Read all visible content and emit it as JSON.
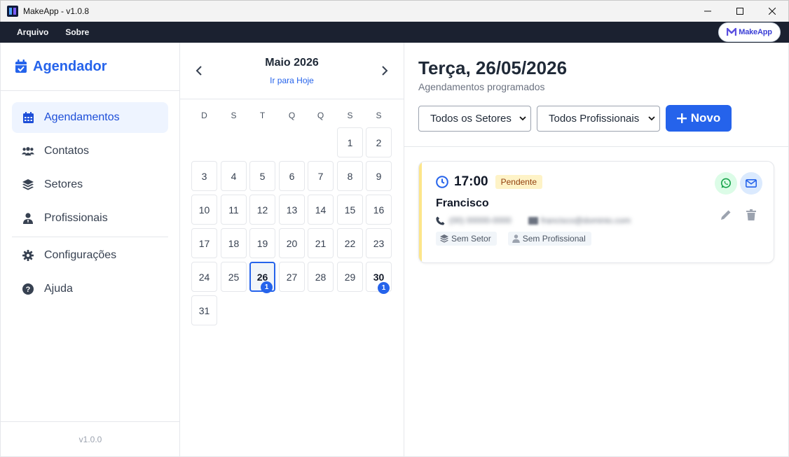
{
  "window": {
    "title": "MakeApp - v1.0.8"
  },
  "menubar": {
    "items": [
      "Arquivo",
      "Sobre"
    ],
    "brand": "MakeApp"
  },
  "sidebar": {
    "title": "Agendador",
    "items": [
      {
        "label": "Agendamentos",
        "icon": "calendar-icon",
        "active": true
      },
      {
        "label": "Contatos",
        "icon": "users-icon"
      },
      {
        "label": "Setores",
        "icon": "layers-icon"
      },
      {
        "label": "Profissionais",
        "icon": "user-tie-icon"
      },
      {
        "label": "Configurações",
        "icon": "gear-icon"
      },
      {
        "label": "Ajuda",
        "icon": "help-icon"
      }
    ],
    "version": "v1.0.0"
  },
  "calendar": {
    "month_label": "Maio 2026",
    "today_link": "Ir para Hoje",
    "weekdays": [
      "D",
      "S",
      "T",
      "Q",
      "Q",
      "S",
      "S"
    ],
    "first_weekday_index": 5,
    "days_in_month": 31,
    "selected_day": 26,
    "day_counts": {
      "26": "1",
      "30": "1"
    }
  },
  "main": {
    "title": "Terça, 26/05/2026",
    "subtitle": "Agendamentos programados",
    "filter_sector": "Todos os Setores",
    "filter_professional": "Todos Profissionais",
    "new_button": "Novo"
  },
  "appointment": {
    "time": "17:00",
    "status": "Pendente",
    "name": "Francisco",
    "phone": "(00) 00000-0000",
    "email": "francisco@dominio.com",
    "sector": "Sem Setor",
    "professional": "Sem Profissional"
  },
  "colors": {
    "accent": "#2563eb",
    "pending": "#fde68a",
    "whatsapp": "#16a34a"
  }
}
